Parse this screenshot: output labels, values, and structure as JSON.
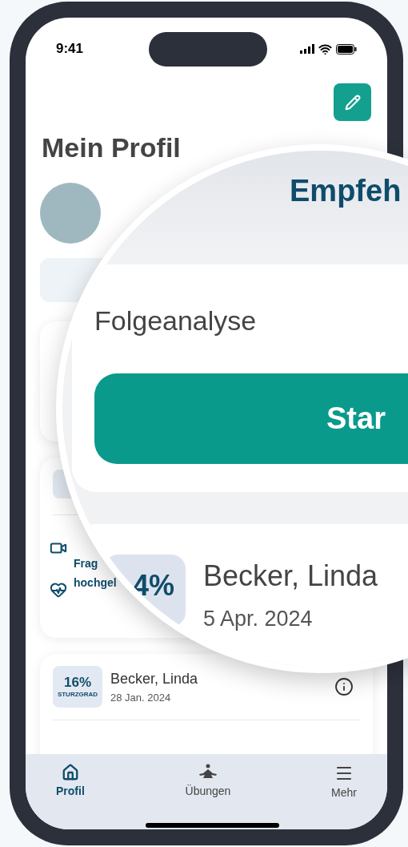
{
  "status_bar": {
    "time": "9:41"
  },
  "header": {
    "title": "Mein Profil"
  },
  "history_card": {
    "note_lines": [
      "Frag",
      "hochgel"
    ]
  },
  "magnifier": {
    "heading": "Empfeh",
    "card_title": "Folgeanalyse",
    "start_button": "Star",
    "result": {
      "score": "4%",
      "name": "Becker, Linda",
      "date": "5 Apr. 2024"
    }
  },
  "results": [
    {
      "score": "16%",
      "score_label": "STURZGRAD",
      "name": "Becker, Linda",
      "date": "28 Jan. 2024"
    }
  ],
  "bottom_nav": [
    {
      "label": "Profil",
      "kind": "home",
      "selected": true
    },
    {
      "label": "Übungen",
      "kind": "meditation",
      "selected": false
    },
    {
      "label": "Mehr",
      "kind": "menu",
      "selected": false
    }
  ]
}
